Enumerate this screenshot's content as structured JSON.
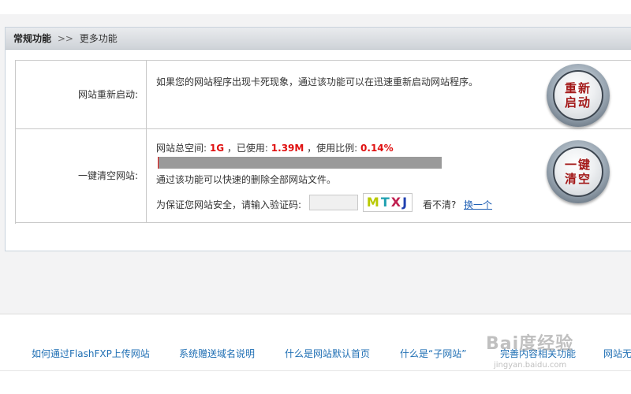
{
  "breadcrumb": {
    "section": "常规功能",
    "separator": ">>",
    "current": "更多功能"
  },
  "restart": {
    "label": "网站重新启动:",
    "description": "如果您的网站程序出现卡死现象，通过该功能可以在迅速重新启动网站程序。",
    "button_line1": "重新",
    "button_line2": "启动"
  },
  "clear": {
    "label": "一键清空网站:",
    "space_prefix": "网站总空间:",
    "space_total": "1G",
    "used_prefix": "，已使用:",
    "space_used": "1.39M",
    "ratio_prefix": "，使用比例:",
    "usage_ratio": "0.14%",
    "usage_fraction": 0.0014,
    "description": "通过该功能可以快速的删除全部网站文件。",
    "captcha_prompt": "为保证您网站安全，请输入验证码:",
    "captcha_value": "",
    "captcha_chars": [
      "M",
      "T",
      "X",
      "J"
    ],
    "unclear_text": "看不清?",
    "refresh_link": "换一个",
    "button_line1": "一键",
    "button_line2": "清空"
  },
  "footer": {
    "links": [
      "如何通过FlashFXP上传网站",
      "系统赠送域名说明",
      "什么是网站默认首页",
      "什么是“子网站”",
      "完善内容相关功能",
      "网站无"
    ]
  },
  "watermark": {
    "brand": "Bai度经验",
    "url": "jingyan.baidu.com"
  },
  "colors": {
    "accent_red": "#e01010",
    "link_blue": "#1f6fb4",
    "button_text": "#a31818"
  }
}
